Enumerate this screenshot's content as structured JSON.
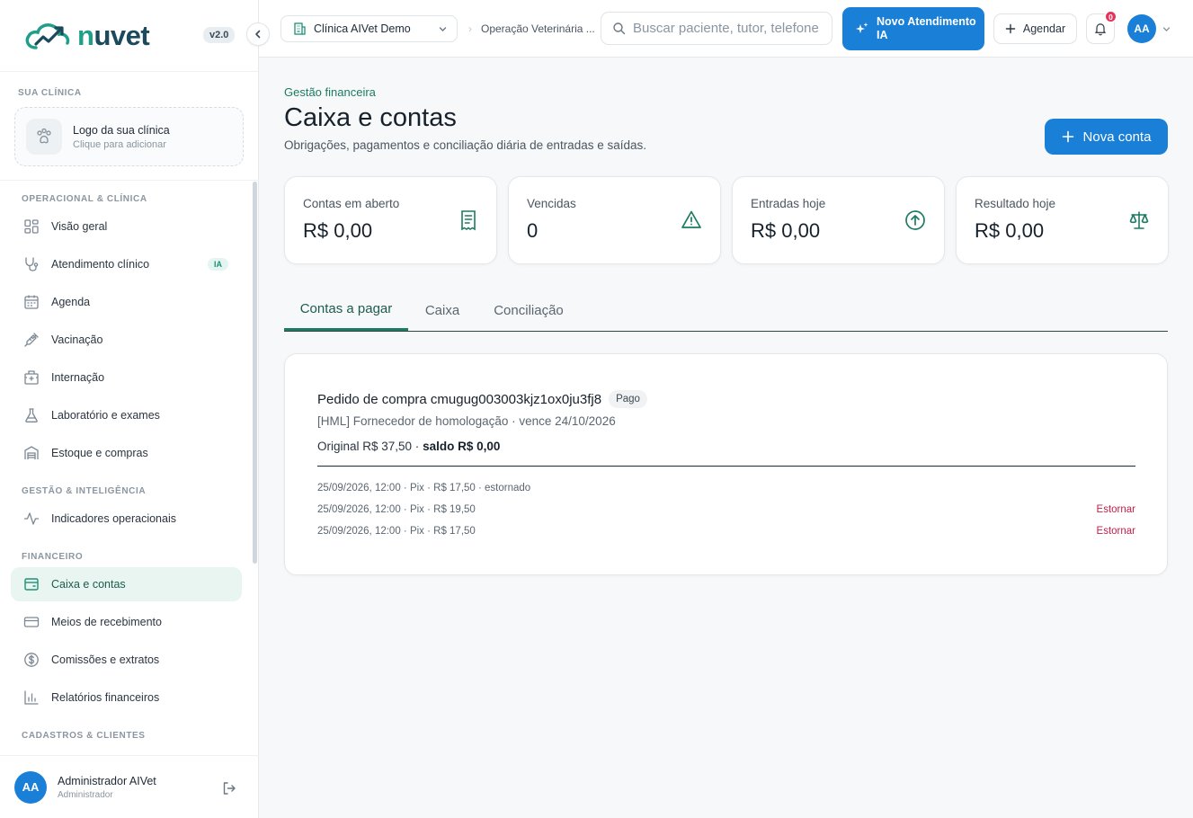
{
  "brand": {
    "name_n": "n",
    "name_rest": "uvet",
    "version": "v2.0"
  },
  "sidebar": {
    "clinic_section": "SUA CLÍNICA",
    "clinic_card": {
      "title": "Logo da sua clínica",
      "subtitle": "Clique para adicionar"
    },
    "groups": [
      {
        "label": "OPERACIONAL & CLÍNICA"
      },
      {
        "label": "GESTÃO & INTELIGÊNCIA"
      },
      {
        "label": "FINANCEIRO"
      },
      {
        "label": "CADASTROS & CLIENTES"
      }
    ],
    "items": [
      {
        "label": "Visão geral",
        "icon": "grid-icon"
      },
      {
        "label": "Atendimento clínico",
        "icon": "stethoscope-icon",
        "badge": "IA"
      },
      {
        "label": "Agenda",
        "icon": "calendar-icon"
      },
      {
        "label": "Vacinação",
        "icon": "syringe-icon"
      },
      {
        "label": "Internação",
        "icon": "hospital-icon"
      },
      {
        "label": "Laboratório e exames",
        "icon": "flask-icon"
      },
      {
        "label": "Estoque e compras",
        "icon": "warehouse-icon"
      },
      {
        "label": "Indicadores operacionais",
        "icon": "activity-icon"
      },
      {
        "label": "Caixa e contas",
        "icon": "wallet-icon",
        "active": true
      },
      {
        "label": "Meios de recebimento",
        "icon": "credit-card-icon"
      },
      {
        "label": "Comissões e extratos",
        "icon": "dollar-circle-icon"
      },
      {
        "label": "Relatórios financeiros",
        "icon": "bar-chart-icon"
      }
    ],
    "user": {
      "initials": "AA",
      "name": "Administrador AIVet",
      "role": "Administrador"
    }
  },
  "topbar": {
    "clinic_select": "Clínica AIVet Demo",
    "breadcrumb": "Operação Veterinária ...",
    "search_placeholder": "Buscar paciente, tutor, telefone",
    "ai_button": "Novo Atendimento IA",
    "schedule_button": "Agendar",
    "notifications": "0",
    "avatar": "AA"
  },
  "page": {
    "eyebrow": "Gestão financeira",
    "title": "Caixa e contas",
    "subtitle": "Obrigações, pagamentos e conciliação diária de entradas e saídas.",
    "new_button": "Nova conta"
  },
  "stats": [
    {
      "label": "Contas em aberto",
      "value": "R$ 0,00",
      "icon": "receipt-icon"
    },
    {
      "label": "Vencidas",
      "value": "0",
      "icon": "warning-icon"
    },
    {
      "label": "Entradas hoje",
      "value": "R$ 0,00",
      "icon": "arrow-up-circle-icon"
    },
    {
      "label": "Resultado hoje",
      "value": "R$ 0,00",
      "icon": "scale-icon"
    }
  ],
  "tabs": [
    {
      "label": "Contas a pagar",
      "active": true
    },
    {
      "label": "Caixa"
    },
    {
      "label": "Conciliação"
    }
  ],
  "order": {
    "title": "Pedido de compra cmugug003003kjz1ox0ju3fj8",
    "status": "Pago",
    "meta": "[HML] Fornecedor de homologação · vence 24/10/2026",
    "original": "Original R$ 37,50 ·",
    "balance": "saldo R$ 0,00",
    "payments": [
      {
        "text": "25/09/2026, 12:00 · Pix · R$ 17,50 · estornado",
        "action": ""
      },
      {
        "text": "25/09/2026, 12:00 · Pix · R$ 19,50",
        "action": "Estornar"
      },
      {
        "text": "25/09/2026, 12:00 · Pix · R$ 17,50",
        "action": "Estornar"
      }
    ]
  },
  "colors": {
    "primary": "#1a7fd6",
    "brand_green": "#1f9e8a",
    "active_bg": "#e8f5f0",
    "danger": "#c4214b"
  }
}
